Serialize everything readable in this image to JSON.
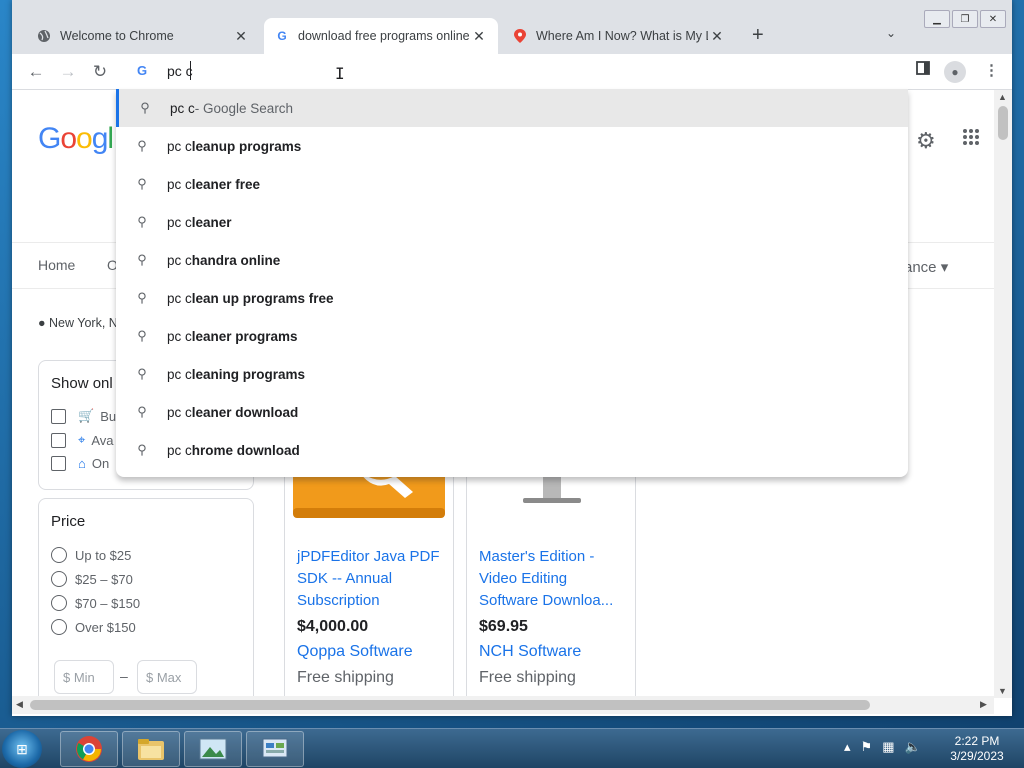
{
  "tabs": [
    {
      "title": "Welcome to Chrome",
      "icon": "globe-icon",
      "close": "✕"
    },
    {
      "title": "download free programs online -",
      "icon": "google-icon",
      "close": "✕"
    },
    {
      "title": "Where Am I Now? What is My Lo",
      "icon": "map-pin-icon",
      "close": "✕"
    }
  ],
  "toolbar": {
    "new_tab": "+",
    "tab_search": "⌄"
  },
  "omnibox": {
    "text": "pc c"
  },
  "suggestions": [
    {
      "typed": "pc c",
      "rest": "",
      "suffix": " - Google Search",
      "highlighted": true
    },
    {
      "typed": "pc c",
      "rest": "leanup programs"
    },
    {
      "typed": "pc c",
      "rest": "leaner free"
    },
    {
      "typed": "pc c",
      "rest": "leaner"
    },
    {
      "typed": "pc c",
      "rest": "handra online"
    },
    {
      "typed": "pc c",
      "rest": "lean up programs free"
    },
    {
      "typed": "pc c",
      "rest": "leaner programs"
    },
    {
      "typed": "pc c",
      "rest": "leaning programs"
    },
    {
      "typed": "pc c",
      "rest": "leaner download"
    },
    {
      "typed": "pc c",
      "rest": "hrome download"
    }
  ],
  "page": {
    "nav_home": "Home",
    "nav_partial": "O",
    "nav_right": "ance ▾",
    "location": "● New York, N",
    "filters": {
      "title": "Show onl",
      "items": [
        {
          "label": "Bu",
          "icon": "cart-icon"
        },
        {
          "label": "Ava",
          "icon": "map-pin-icon"
        },
        {
          "label": "On",
          "icon": "tag-icon"
        }
      ]
    },
    "price": {
      "title": "Price",
      "options": [
        "Up to $25",
        "$25 – $70",
        "$70 – $150",
        "Over $150"
      ],
      "min_placeholder": "$ Min",
      "max_placeholder": "$ Max",
      "dash": "–"
    },
    "products": [
      {
        "title": "jPDFEditor Java PDF SDK -- Annual Subscription",
        "price": "$4,000.00",
        "seller": "Qoppa Software",
        "shipping": "Free shipping"
      },
      {
        "title": "Master's Edition - Video Editing Software Downloa...",
        "price": "$69.95",
        "seller": "NCH Software",
        "shipping": "Free shipping"
      }
    ]
  },
  "taskbar": {
    "time": "2:22 PM",
    "date": "3/29/2023"
  }
}
